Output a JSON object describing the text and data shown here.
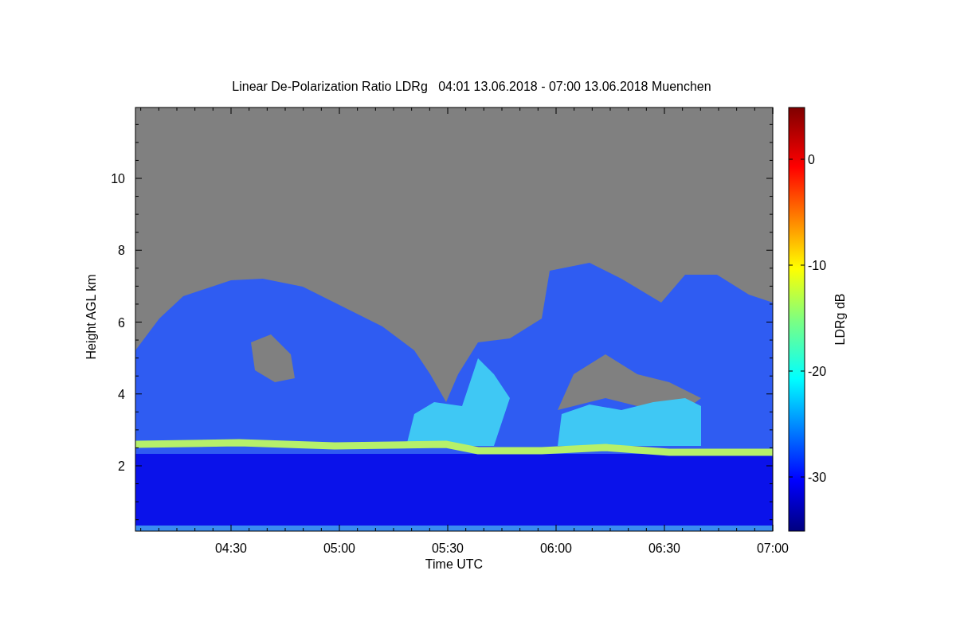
{
  "figure": {
    "title": "Linear De-Polarization Ratio LDRg   04:01 13.06.2018 - 07:00 13.06.2018 Muenchen",
    "xlabel": "Time UTC",
    "ylabel": "Height AGL km",
    "xticks": [
      "04:30",
      "05:00",
      "05:30",
      "06:00",
      "06:30",
      "07:00"
    ],
    "yticks": [
      "10",
      "8",
      "6",
      "4",
      "2"
    ],
    "colorbar": {
      "label": "LDRg dB",
      "ticks": [
        "0",
        "-10",
        "-20",
        "-30"
      ]
    }
  }
}
